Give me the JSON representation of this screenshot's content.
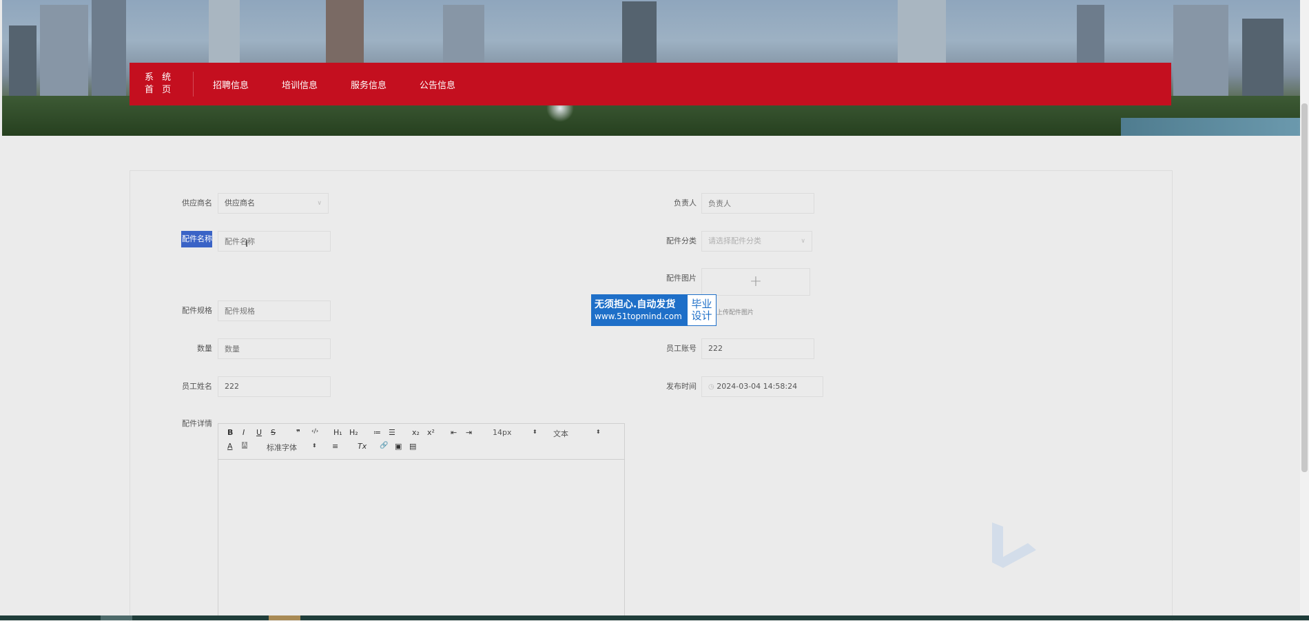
{
  "nav": {
    "home_line1": "系 统",
    "home_line2": "首 页",
    "items": [
      "招聘信息",
      "培训信息",
      "服务信息",
      "公告信息"
    ]
  },
  "form": {
    "supplier": {
      "label": "供应商名",
      "value": "供应商名"
    },
    "person_in_charge": {
      "label": "负责人",
      "placeholder": "负责人"
    },
    "part_name": {
      "label": "配件名称",
      "placeholder": "配件名称"
    },
    "part_category": {
      "label": "配件分类",
      "placeholder": "请选择配件分类"
    },
    "part_image": {
      "label": "配件图片",
      "upload_symbol": "+",
      "tip": "上传配件图片"
    },
    "part_spec": {
      "label": "配件规格",
      "placeholder": "配件规格"
    },
    "quantity": {
      "label": "数量",
      "placeholder": "数量"
    },
    "employee_account": {
      "label": "员工账号",
      "value": "222"
    },
    "employee_name": {
      "label": "员工姓名",
      "value": "222"
    },
    "publish_time": {
      "label": "发布时间",
      "value": "2024-03-04 14:58:24"
    },
    "part_detail": {
      "label": "配件详情"
    }
  },
  "editor_toolbar": {
    "bold": "B",
    "italic": "I",
    "underline": "U",
    "strike": "S",
    "quote": "❞",
    "code": "‹/›",
    "h1": "H₁",
    "h2": "H₂",
    "ordered": "≔",
    "bullet": "☰",
    "sub": "x₂",
    "sup": "x²",
    "outdent": "⇤",
    "indent": "⇥",
    "size": "14px",
    "header": "文本",
    "font": "标准字体",
    "color": "A",
    "background": "A",
    "align": "≡",
    "clean": "Tx",
    "link": "🔗",
    "image": "▣",
    "video": "▤"
  },
  "watermark": {
    "line1": "无须担心.自动发货",
    "line2": "www.51topmind.com",
    "right1": "毕业",
    "right2": "设计"
  },
  "colors": {
    "nav": "#c40f1f",
    "highlight": "#3a63c6",
    "watermark": "#1e6fc8"
  }
}
